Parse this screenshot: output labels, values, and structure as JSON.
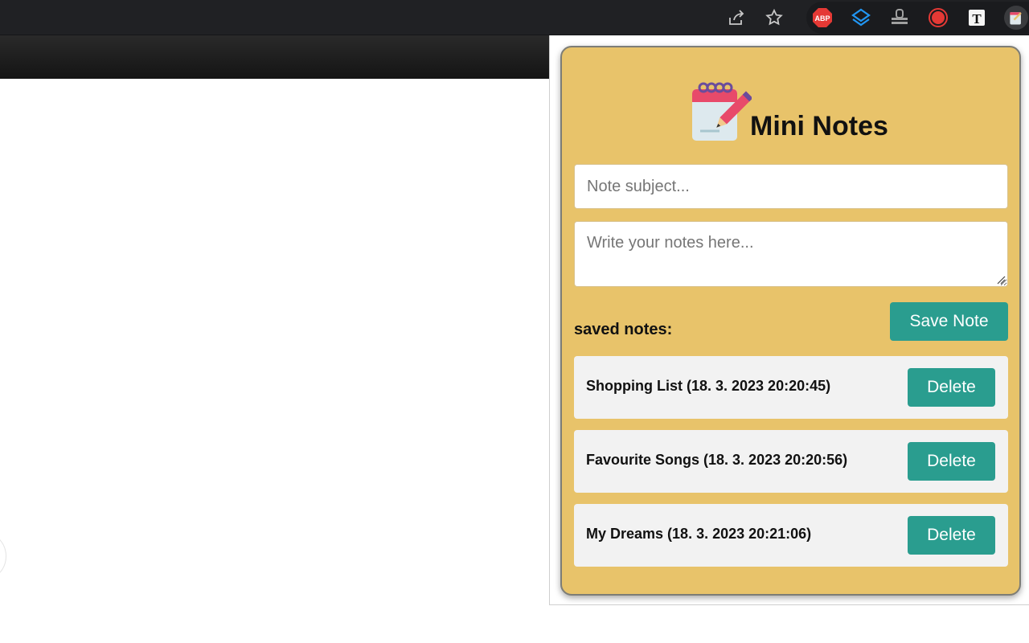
{
  "browser": {
    "toolbar_icons": [
      "share-icon",
      "star-icon"
    ],
    "extensions": [
      {
        "name": "adblock-plus-icon",
        "label": "ABP",
        "color": "#e53935"
      },
      {
        "name": "layers-icon",
        "color": "#2196f3"
      },
      {
        "name": "stack-icon",
        "color": "#9e9e9e"
      },
      {
        "name": "record-icon",
        "color": "#e53935"
      },
      {
        "name": "text-t-icon",
        "label": "T",
        "color": "#ffffff"
      },
      {
        "name": "notepad-icon",
        "color": "#e8c36a"
      }
    ]
  },
  "popup": {
    "title": "Mini Notes",
    "subject_placeholder": "Note subject...",
    "notes_placeholder": "Write your notes here...",
    "save_label": "Save Note",
    "saved_label": "saved notes:",
    "accent_color": "#2a9d8f",
    "background_color": "#e8c36a",
    "notes": [
      {
        "text": "Shopping List (18. 3. 2023 20:20:45)",
        "delete_label": "Delete"
      },
      {
        "text": "Favourite Songs (18. 3. 2023 20:20:56)",
        "delete_label": "Delete"
      },
      {
        "text": "My Dreams (18. 3. 2023 20:21:06)",
        "delete_label": "Delete"
      }
    ]
  }
}
